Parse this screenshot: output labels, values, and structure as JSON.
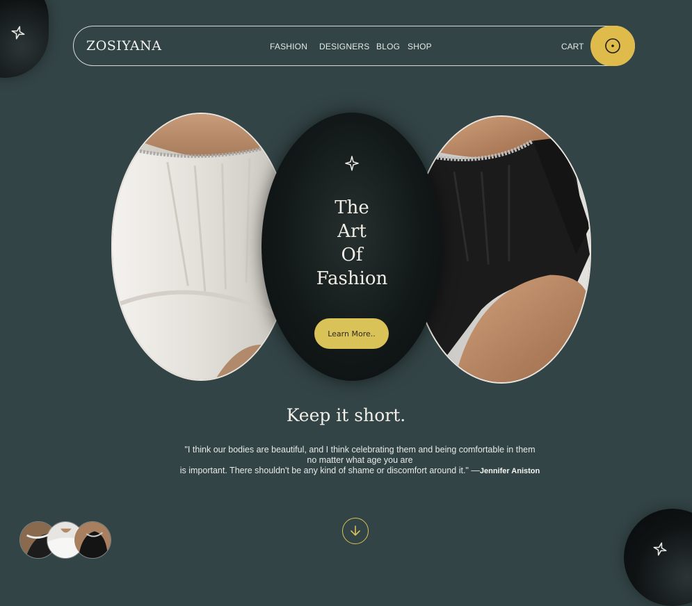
{
  "brand": {
    "logo": "ZOSIYANA"
  },
  "nav": {
    "links": [
      {
        "label": "FASHION"
      },
      {
        "label": "DESIGNERS"
      },
      {
        "label": "BLOG"
      },
      {
        "label": "SHOP"
      }
    ],
    "cart_label": "CART",
    "cart_icon": "target-icon"
  },
  "hero": {
    "title_lines": [
      "The",
      "Art",
      "Of",
      "Fashion"
    ],
    "cta_label": "Learn More..",
    "icon": "sparkle-star-icon",
    "photos": [
      {
        "name": "white-corset-dress-photo",
        "tone": "#e6e4df"
      },
      {
        "name": "black-corset-dress-photo",
        "tone": "#1d1d1d"
      }
    ]
  },
  "quote_section": {
    "title": "Keep it short.",
    "line1": "\"I think our bodies are beautiful, and I think celebrating them and being comfortable in them",
    "line2": "no matter what age you are",
    "line3": "is important. There shouldn't be any kind of shame or discomfort around it.\" —",
    "author": "Jennifer Aniston"
  },
  "footer": {
    "scroll_icon": "arrow-down-circle-icon",
    "thumbnails": [
      {
        "name": "thumbnail-1"
      },
      {
        "name": "thumbnail-2"
      },
      {
        "name": "thumbnail-3"
      }
    ]
  },
  "colors": {
    "background": "#334446",
    "accent": "#dfbb4c",
    "dark": "#0c1010",
    "text": "#e9ecea"
  }
}
